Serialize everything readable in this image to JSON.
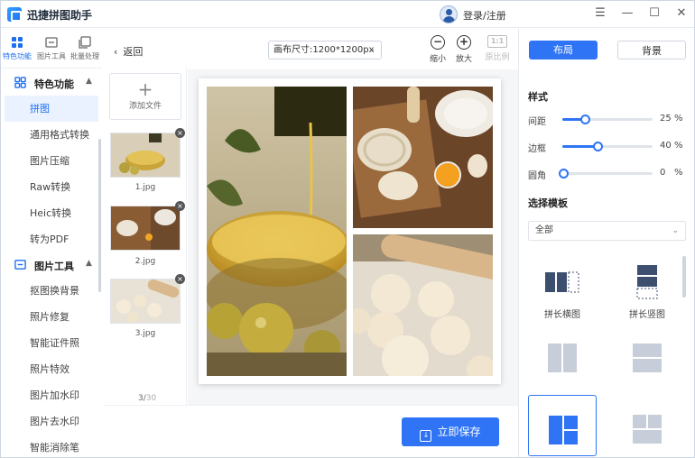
{
  "app": {
    "title": "迅捷拼图助手",
    "login": "登录/注册"
  },
  "window_controls": [
    "☰",
    "—",
    "☐",
    "✕"
  ],
  "rail_tabs": [
    {
      "label": "特色功能",
      "icon": "grid-icon",
      "active": true
    },
    {
      "label": "图片工具",
      "icon": "image-tool-icon",
      "active": false
    },
    {
      "label": "批量处理",
      "icon": "batch-icon",
      "active": false
    }
  ],
  "nav": {
    "group1": {
      "label": "特色功能",
      "icon": "grid-icon"
    },
    "items1": [
      "拼图",
      "通用格式转换",
      "图片压缩",
      "Raw转换",
      "Heic转换",
      "转为PDF"
    ],
    "group2": {
      "label": "图片工具",
      "icon": "image-tool-icon"
    },
    "items2": [
      "抠图换背景",
      "照片修复",
      "智能证件照",
      "照片特效",
      "图片加水印",
      "图片去水印",
      "智能消除笔"
    ],
    "active_item": "拼图"
  },
  "files": {
    "back": "返回",
    "add_label": "添加文件",
    "items": [
      {
        "name": "1.jpg"
      },
      {
        "name": "2.jpg"
      },
      {
        "name": "3.jpg"
      }
    ],
    "count_current": "3/",
    "count_total": "30"
  },
  "toolbar": {
    "canvas_size": "画布尺寸:1200*1200px",
    "zoom_out": "缩小",
    "zoom_in": "放大",
    "original_badge": "1:1",
    "original": "原比例"
  },
  "save": {
    "label": "立即保存"
  },
  "right_panel": {
    "tabs": [
      {
        "label": "布局",
        "active": true
      },
      {
        "label": "背景",
        "active": false
      }
    ],
    "style_title": "样式",
    "sliders": [
      {
        "label": "间距",
        "value": 25,
        "unit": "%"
      },
      {
        "label": "边框",
        "value": 40,
        "unit": "%"
      },
      {
        "label": "圆角",
        "value": 0,
        "unit": "%"
      }
    ],
    "template_title": "选择模板",
    "template_filter": "全部",
    "templates": [
      {
        "label": "拼长横图"
      },
      {
        "label": "拼长竖图"
      },
      {
        "label": ""
      },
      {
        "label": ""
      },
      {
        "label": "",
        "selected": true
      },
      {
        "label": ""
      }
    ]
  },
  "colors": {
    "accent": "#2f74f5",
    "brand": "#1e6ff0",
    "active_bg": "#eaf2ff"
  }
}
